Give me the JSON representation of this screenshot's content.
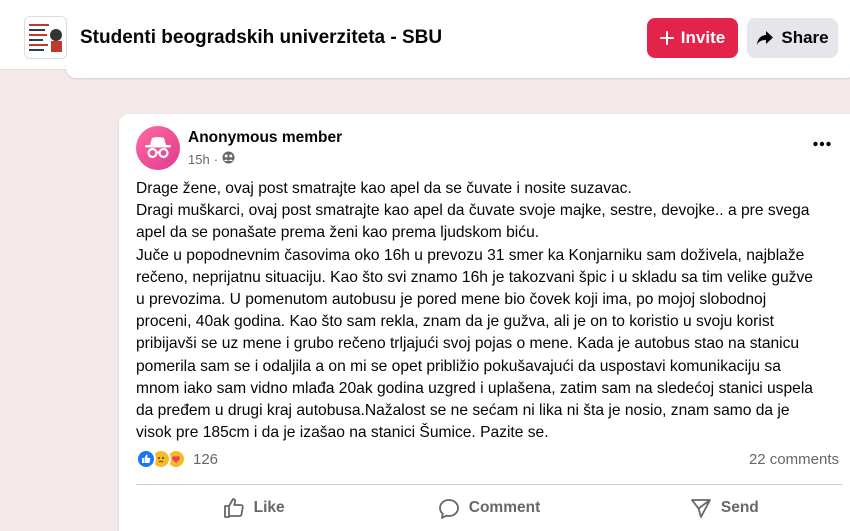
{
  "header": {
    "group_name": "Studenti beogradskih univerziteta - SBU",
    "invite_label": "Invite",
    "share_label": "Share"
  },
  "post": {
    "author": "Anonymous member",
    "time": "15h",
    "privacy_icon": "group-icon",
    "body_lines": [
      "Drage žene, ovaj post smatrajte kao apel da se čuvate i nosite suzavac.",
      "Dragi muškarci, ovaj post smatrajte kao apel da čuvate svoje majke, sestre, devojke.. a pre svega",
      "apel da se ponašate prema ženi kao prema ljudskom biću.",
      "Juče u popodnevnim časovima oko 16h u prevozu 31 smer ka Konjarniku sam doživela, najblaže",
      "rečeno, neprijatnu situaciju. Kao što svi znamo 16h je takozvani špic i u skladu sa tim velike gužve",
      "u prevozima. U pomenutom autobusu je pored mene bio čovek koji ima, po mojoj slobodnoj",
      "proceni, 40ak godina. Kao što sam rekla, znam da je gužva, ali je on to koristio u svoju korist",
      "pribijavši se uz mene i grubo rečeno trljajući svoj pojas o mene. Kada je autobus stao na stanicu",
      "pomerila sam se i odaljila a on mi se opet približio pokušavajući da uspostavi komunikaciju sa",
      "mnom iako sam vidno mlađa 20ak godina uzgred i uplašena, zatim sam na sledećoj stanici uspela",
      "da pređem u drugi kraj autobusa.Nažalost se ne sećam ni lika ni šta je nosio, znam samo da je",
      "visok pre 185cm i da je izašao na stanici Šumice. Pazite se."
    ],
    "reaction_count": "126",
    "comments_label": "22 comments",
    "actions": {
      "like": "Like",
      "comment": "Comment",
      "send": "Send"
    }
  },
  "colors": {
    "page_background": "#f3e9e9",
    "invite_button": "#e4234b",
    "share_button": "#e4e6eb",
    "like_reaction": "#1877f2",
    "secondary_text": "#65676b"
  }
}
